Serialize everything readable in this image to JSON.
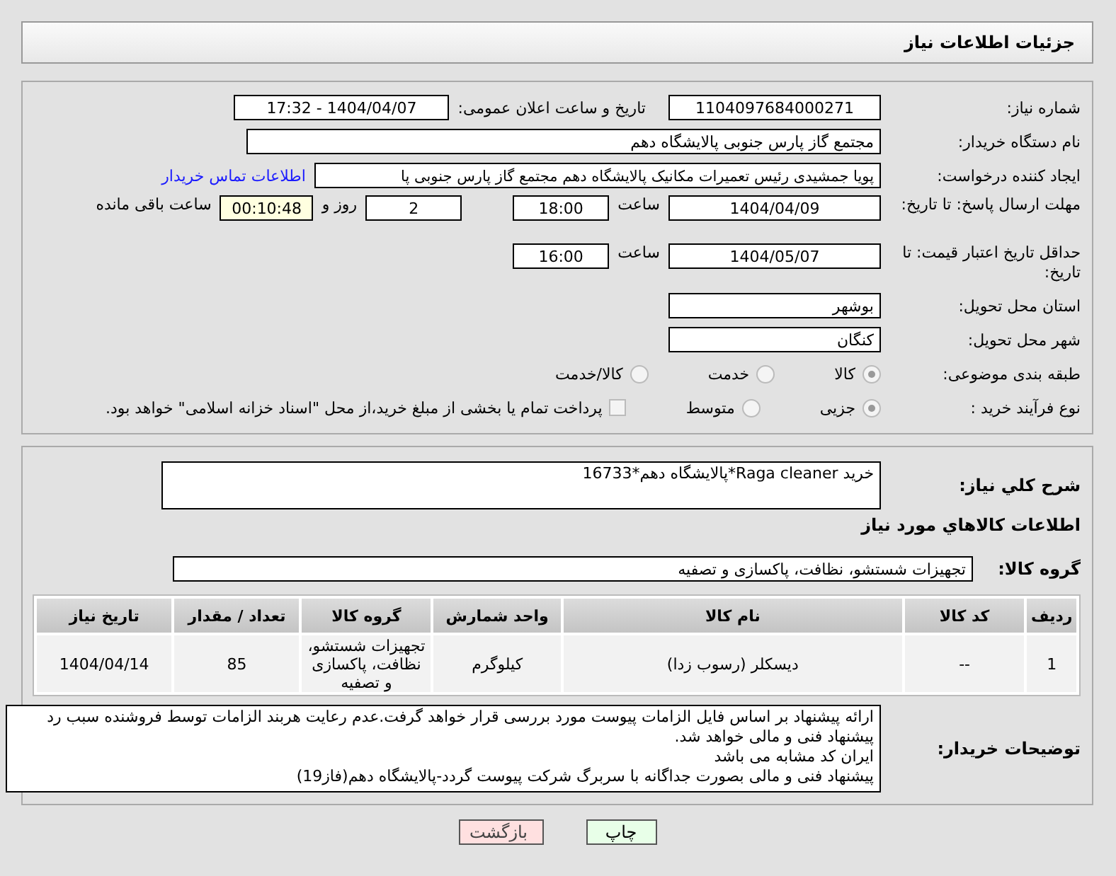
{
  "header": {
    "title": "جزئیات اطلاعات نیاز"
  },
  "need_number": {
    "label": "شماره نیاز:",
    "value": "1104097684000271"
  },
  "announce": {
    "label": "تاریخ و ساعت اعلان عمومی:",
    "value": "1404/04/07 - 17:32"
  },
  "buyer_org": {
    "label": "نام دستگاه خریدار:",
    "value": "مجتمع گاز پارس جنوبی  پالایشگاه دهم"
  },
  "requester": {
    "label": "ایجاد کننده درخواست:",
    "value": "پویا جمشیدی رئیس تعمیرات مکانیک پالایشگاه دهم  مجتمع گاز پارس جنوبی  پا",
    "link": "اطلاعات تماس خریدار"
  },
  "deadline": {
    "label": "مهلت ارسال پاسخ: تا تاریخ:",
    "date": "1404/04/09",
    "time_label": "ساعت",
    "time": "18:00",
    "days": "2",
    "days_label": "روز و",
    "remaining": "00:10:48",
    "remaining_label": "ساعت باقی مانده"
  },
  "validity": {
    "label": "حداقل تاریخ اعتبار قیمت: تا تاریخ:",
    "date": "1404/05/07",
    "time_label": "ساعت",
    "time": "16:00"
  },
  "province": {
    "label": "استان محل تحویل:",
    "value": "بوشهر"
  },
  "city": {
    "label": "شهر محل تحویل:",
    "value": "کنگان"
  },
  "category": {
    "label": "طبقه بندی موضوعی:",
    "options": [
      {
        "label": "کالا",
        "selected": true
      },
      {
        "label": "خدمت",
        "selected": false
      },
      {
        "label": "کالا/خدمت",
        "selected": false
      }
    ]
  },
  "process": {
    "label": "نوع فرآیند خرید :",
    "options": [
      {
        "label": "جزیی",
        "selected": true
      },
      {
        "label": "متوسط",
        "selected": false
      }
    ],
    "checkbox": {
      "label": "پرداخت تمام یا بخشی از مبلغ خرید،از محل \"اسناد خزانه اسلامی\" خواهد بود.",
      "checked": false
    }
  },
  "summary": {
    "label": "شرح کلي نياز:",
    "value": "خرید Raga cleaner*پالایشگاه دهم*16733"
  },
  "goods_title": "اطلاعات کالاهاي مورد نياز",
  "goods_group": {
    "label": "گروه کالا:",
    "value": "تجهیزات شستشو، نظافت، پاکسازی و تصفیه"
  },
  "table": {
    "columns": [
      "ردیف",
      "کد کالا",
      "نام کالا",
      "واحد شمارش",
      "گروه کالا",
      "تعداد / مقدار",
      "تاریخ نیاز"
    ],
    "rows": [
      [
        "1",
        "--",
        "دیسکلر (رسوب زدا)",
        "کیلوگرم",
        "تجهیزات شستشو، نظافت، پاکسازی و تصفیه",
        "85",
        "1404/04/14"
      ]
    ]
  },
  "buyer_notes": {
    "label": "توضیحات خریدار:",
    "value": "ارائه پیشنهاد بر اساس فایل الزامات پیوست مورد بررسی قرار خواهد گرفت.عدم رعایت هربند الزامات توسط فروشنده سبب رد پیشنهاد فنی و مالی خواهد شد.\nایران کد مشابه می باشد\nپیشنهاد فنی و مالی بصورت جداگانه با سربرگ شرکت پیوست گردد-پالایشگاه دهم(فاز19)"
  },
  "buttons": [
    {
      "label": "چاپ",
      "kind": "print"
    },
    {
      "label": "بازگشت",
      "kind": "back"
    }
  ]
}
